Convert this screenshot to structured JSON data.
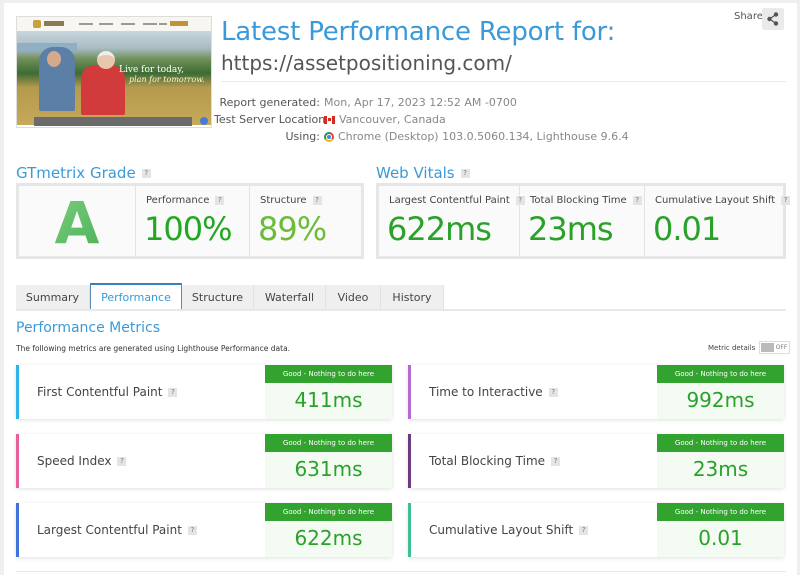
{
  "header": {
    "title": "Latest Performance Report for:",
    "url": "https://assetpositioning.com/",
    "share_label": "Share",
    "screenshot": {
      "tagline_1": "Live for today,",
      "tagline_2": "plan for tomorrow."
    },
    "info": [
      {
        "label": "Report generated:",
        "value": "Mon, Apr 17, 2023 12:52 AM -0700",
        "icon": "none"
      },
      {
        "label": "Test Server Location:",
        "value": "Vancouver, Canada",
        "icon": "canada-flag-icon"
      },
      {
        "label": "Using:",
        "value": "Chrome (Desktop) 103.0.5060.134, Lighthouse 9.6.4",
        "icon": "chrome-icon"
      }
    ]
  },
  "grade": {
    "heading": "GTmetrix Grade",
    "letter": "A",
    "performance": {
      "label": "Performance",
      "value": "100%",
      "color": "#21a821"
    },
    "structure": {
      "label": "Structure",
      "value": "89%",
      "color": "#6cbc3a"
    }
  },
  "vitals": {
    "heading": "Web Vitals",
    "items": [
      {
        "label": "Largest Contentful Paint",
        "value": "622ms"
      },
      {
        "label": "Total Blocking Time",
        "value": "23ms"
      },
      {
        "label": "Cumulative Layout Shift",
        "value": "0.01"
      }
    ],
    "color": "#2aa12a"
  },
  "tabs": [
    {
      "label": "Summary",
      "active": false
    },
    {
      "label": "Performance",
      "active": true
    },
    {
      "label": "Structure",
      "active": false
    },
    {
      "label": "Waterfall",
      "active": false
    },
    {
      "label": "Video",
      "active": false
    },
    {
      "label": "History",
      "active": false
    }
  ],
  "metrics": {
    "title": "Performance Metrics",
    "subtitle": "The following metrics are generated using Lighthouse Performance data.",
    "details_label": "Metric details",
    "toggle_state": "OFF",
    "items": [
      {
        "name": "First Contentful Paint",
        "status": "Good - Nothing to do here",
        "value": "411ms",
        "color": "#2fb4e9"
      },
      {
        "name": "Time to Interactive",
        "status": "Good - Nothing to do here",
        "value": "992ms",
        "color": "#b36ad4"
      },
      {
        "name": "Speed Index",
        "status": "Good - Nothing to do here",
        "value": "631ms",
        "color": "#e8609a"
      },
      {
        "name": "Total Blocking Time",
        "status": "Good - Nothing to do here",
        "value": "23ms",
        "color": "#6b3b7d"
      },
      {
        "name": "Largest Contentful Paint",
        "status": "Good - Nothing to do here",
        "value": "622ms",
        "color": "#3f73d9"
      },
      {
        "name": "Cumulative Layout Shift",
        "status": "Good - Nothing to do here",
        "value": "0.01",
        "color": "#3fbf95"
      }
    ]
  }
}
